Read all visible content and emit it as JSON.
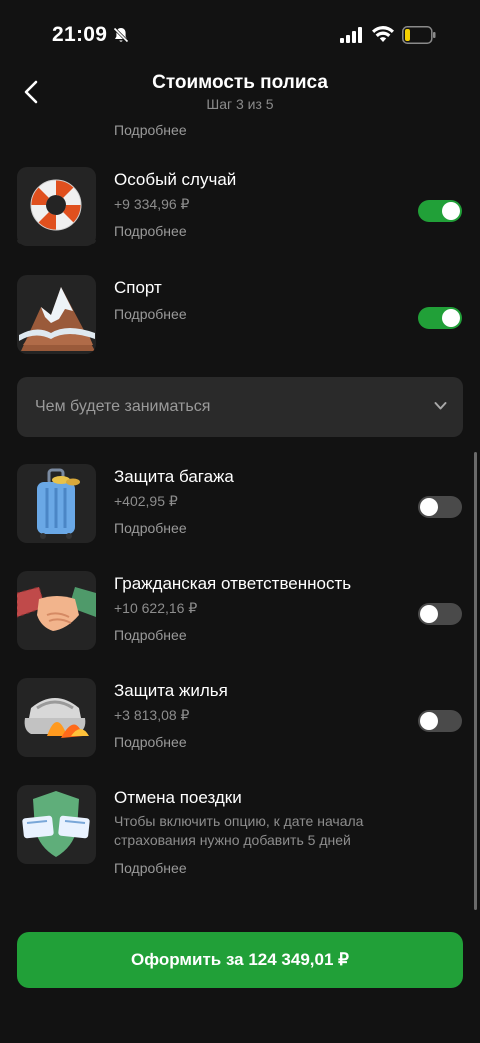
{
  "status_bar": {
    "time": "21:09"
  },
  "nav": {
    "title": "Стоимость полиса",
    "step": "Шаг 3 из 5"
  },
  "partial_item": {
    "more": "Подробнее"
  },
  "items": [
    {
      "name": "Особый случай",
      "price": "+9 334,96 ₽",
      "more": "Подробнее",
      "enabled": true,
      "icon": "lifebuoy-icon"
    },
    {
      "name": "Спорт",
      "more": "Подробнее",
      "enabled": true,
      "icon": "mountain-icon"
    },
    {
      "name": "Защита багажа",
      "price": "+402,95 ₽",
      "more": "Подробнее",
      "enabled": false,
      "icon": "suitcase-icon"
    },
    {
      "name": "Гражданская ответственность",
      "price": "+10 622,16 ₽",
      "more": "Подробнее",
      "enabled": false,
      "icon": "handshake-icon"
    },
    {
      "name": "Защита жилья",
      "price": "+3 813,08 ₽",
      "more": "Подробнее",
      "enabled": false,
      "icon": "fire-iron-icon"
    },
    {
      "name": "Отмена поездки",
      "note": "Чтобы включить опцию, к дате начала страхования нужно добавить 5 дней",
      "more": "Подробнее",
      "icon": "tickets-shield-icon"
    }
  ],
  "sport_select": {
    "placeholder": "Чем будете заниматься"
  },
  "cta": {
    "label": "Оформить за 124 349,01 ₽"
  },
  "colors": {
    "accent": "#21a038",
    "background": "#121212",
    "card": "#2a2a2a"
  }
}
